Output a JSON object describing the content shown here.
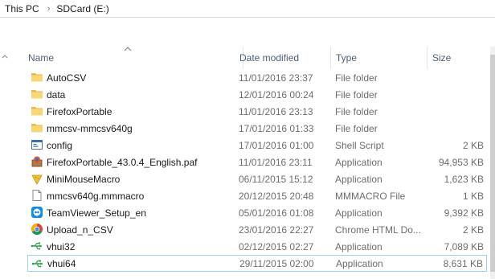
{
  "breadcrumb": {
    "items": [
      "This PC",
      "SDCard (E:)"
    ],
    "separator": "›"
  },
  "columns": {
    "name": "Name",
    "date": "Date modified",
    "type": "Type",
    "size": "Size"
  },
  "colors": {
    "header_text": "#4c607a",
    "folder": "#e8b94a",
    "selection_border": "#99d1ff"
  },
  "files": [
    {
      "name": "AutoCSV",
      "date": "11/01/2016 23:37",
      "type": "File folder",
      "size": "",
      "icon": "folder-icon"
    },
    {
      "name": "data",
      "date": "12/01/2016 00:24",
      "type": "File folder",
      "size": "",
      "icon": "folder-icon"
    },
    {
      "name": "FirefoxPortable",
      "date": "11/01/2016 23:13",
      "type": "File folder",
      "size": "",
      "icon": "folder-icon"
    },
    {
      "name": "mmcsv-mmcsv640g",
      "date": "17/01/2016 01:33",
      "type": "File folder",
      "size": "",
      "icon": "folder-icon"
    },
    {
      "name": "config",
      "date": "17/01/2016 01:00",
      "type": "Shell Script",
      "size": "2 KB",
      "icon": "shell-script-icon"
    },
    {
      "name": "FirefoxPortable_43.0.4_English.paf",
      "date": "11/01/2016 23:11",
      "type": "Application",
      "size": "94,953 KB",
      "icon": "installer-icon"
    },
    {
      "name": "MiniMouseMacro",
      "date": "06/11/2015 15:12",
      "type": "Application",
      "size": "1,623 KB",
      "icon": "cheese-icon"
    },
    {
      "name": "mmcsv640g.mmmacro",
      "date": "20/12/2015 20:48",
      "type": "MMMACRO File",
      "size": "1 KB",
      "icon": "document-icon"
    },
    {
      "name": "TeamViewer_Setup_en",
      "date": "05/01/2016 01:08",
      "type": "Application",
      "size": "9,392 KB",
      "icon": "teamviewer-icon"
    },
    {
      "name": "Upload_n_CSV",
      "date": "23/01/2016 22:27",
      "type": "Chrome HTML Do...",
      "size": "2 KB",
      "icon": "chrome-icon"
    },
    {
      "name": "vhui32",
      "date": "02/12/2015 02:27",
      "type": "Application",
      "size": "7,089 KB",
      "icon": "usb-icon"
    },
    {
      "name": "vhui64",
      "date": "29/11/2015 02:00",
      "type": "Application",
      "size": "8,631 KB",
      "icon": "usb-icon",
      "selected": true
    }
  ]
}
